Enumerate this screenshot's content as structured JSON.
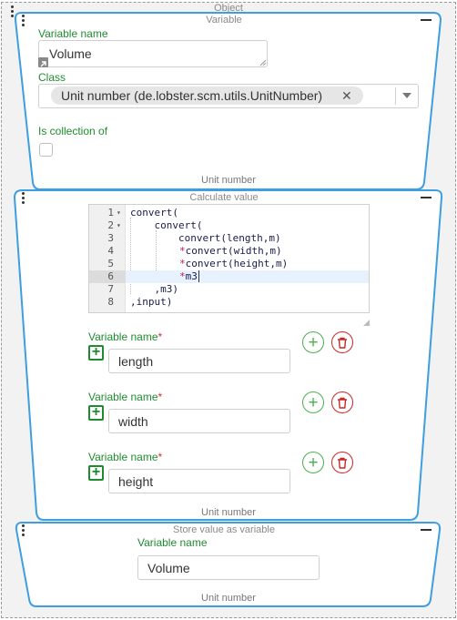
{
  "object_frame": {
    "title": "Object"
  },
  "variable_block": {
    "title": "Variable",
    "variable_name_label": "Variable name",
    "variable_name_value": "Volume",
    "class_label": "Class",
    "class_selected": "Unit number (de.lobster.scm.utils.UnitNumber)",
    "collection_label": "Is collection of",
    "footer": "Unit number"
  },
  "calculate_block": {
    "title": "Calculate value",
    "code_lines": [
      {
        "num": "1",
        "fold": true,
        "text": "convert("
      },
      {
        "num": "2",
        "fold": true,
        "text": "    convert("
      },
      {
        "num": "3",
        "fold": false,
        "text": "        convert(length,m)"
      },
      {
        "num": "4",
        "fold": false,
        "op": "*",
        "text": "convert(width,m)"
      },
      {
        "num": "5",
        "fold": false,
        "op": "*",
        "text": "convert(height,m)"
      },
      {
        "num": "6",
        "fold": false,
        "op": "*",
        "text": "m3",
        "active": true
      },
      {
        "num": "7",
        "fold": false,
        "text": "    ,m3)"
      },
      {
        "num": "8",
        "fold": false,
        "text": ",input)"
      }
    ],
    "variables": [
      {
        "label": "Variable name",
        "required_mark": "*",
        "value": "length"
      },
      {
        "label": "Variable name",
        "required_mark": "*",
        "value": "width"
      },
      {
        "label": "Variable name",
        "required_mark": "*",
        "value": "height"
      }
    ],
    "footer": "Unit number"
  },
  "store_block": {
    "title": "Store value as variable",
    "variable_name_label": "Variable name",
    "variable_name_value": "Volume",
    "footer": "Unit number"
  },
  "colors": {
    "block_border": "#3d9ee0",
    "label_green": "#1e8c2e",
    "delete_red": "#c62828",
    "add_green": "#4caf50"
  },
  "icons": {
    "kebab": "kebab-menu-icon",
    "collapse": "minus-icon",
    "clear": "close-icon",
    "dropdown": "caret-down-icon",
    "resize": "resize-handle-icon",
    "add": "plus-circle-icon",
    "delete": "trash-icon",
    "expand": "plus-square-icon",
    "chip": "chip-remove-icon"
  }
}
